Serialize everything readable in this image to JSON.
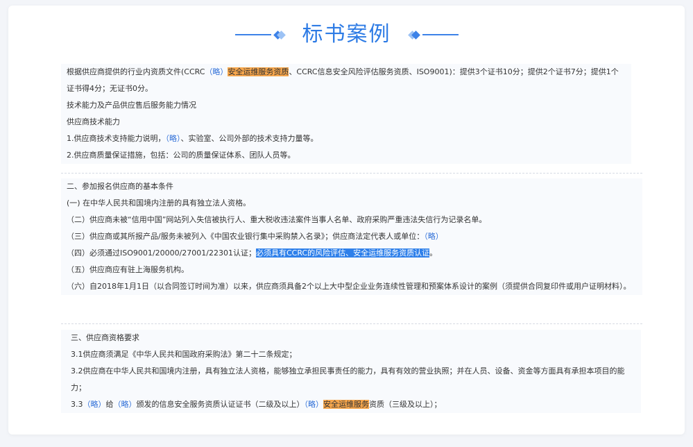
{
  "title": "标书案例",
  "section1": {
    "p1_a": "根据供应商提供的行业内资质文件(CCRC",
    "p1_link": "（略）",
    "p1_hl": "安全运维服务资质",
    "p1_b": "、CCRC信息安全风险评估服务资质、ISO9001)：提供3个证书10分；提供2个证书7分；提供1个证书得4分；无证书0分。",
    "p2": "技术能力及产品供应售后服务能力情况",
    "p3": "供应商技术能力",
    "p4_a": "1.供应商技术支持能力说明，",
    "p4_link": "（略）",
    "p4_b": "、实验室、公司外部的技术支持力量等。",
    "p5": "2.供应商质量保证措施，包括：公司的质量保证体系、团队人员等。"
  },
  "section2": {
    "heading": "二、参加报名供应商的基本条件",
    "i1": "(一) 在中华人民共和国境内注册的具有独立法人资格。",
    "i2": "（二）供应商未被“信用中国”网站列入失信被执行人、重大税收违法案件当事人名单、政府采购严重违法失信行为记录名单。",
    "i3_a": "（三）供应商或其所报产品/服务未被列入《中国农业银行集中采购禁入名录》；供应商法定代表人或单位：",
    "i3_link": "（略）",
    "i4_a": "（四）必须通过ISO9001/20000/27001/22301认证；",
    "i4_hl": "必须具有CCRC的风险评估、安全运维服务资质认证",
    "i4_b": "。",
    "i5": "（五）供应商应有驻上海服务机构。",
    "i6": "（六）自2018年1月1日（以合同签订时间为准）以来，供应商须具备2个以上大中型企业业务连续性管理和预案体系设计的案例（须提供合同复印件或用户证明材料）。"
  },
  "section3": {
    "heading": "三、供应商资格要求",
    "i1": "3.1供应商须满足《中华人民共和国政府采购法》第二十二条规定；",
    "i2": "3.2供应商在中华人民共和国境内注册，具有独立法人资格，能够独立承担民事责任的能力，具有有效的营业执照；并在人员、设备、资金等方面具有承担本项目的能力；",
    "i3_a": "3.3",
    "i3_link1": "（略）",
    "i3_b": "给",
    "i3_link2": "（略）",
    "i3_c": "颁发的信息安全服务资质认证证书（二级及以上）",
    "i3_link3": "（略）",
    "i3_hl": "安全运维服务",
    "i3_d": "资质（三级及以上）；"
  }
}
